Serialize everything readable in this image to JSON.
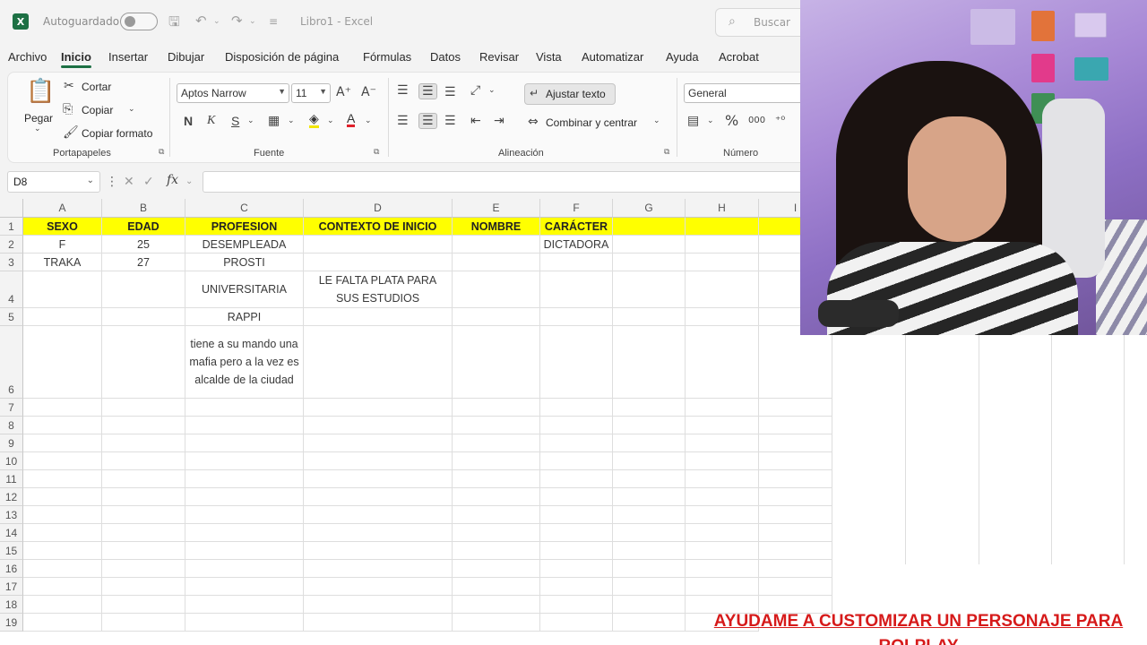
{
  "titlebar": {
    "autosave_label": "Autoguardado",
    "doc_title": "Libro1  -  Excel",
    "search_placeholder": "Buscar"
  },
  "menu": [
    "Archivo",
    "Inicio",
    "Insertar",
    "Dibujar",
    "Disposición de página",
    "Fórmulas",
    "Datos",
    "Revisar",
    "Vista",
    "Automatizar",
    "Ayuda",
    "Acrobat"
  ],
  "active_menu": "Inicio",
  "ribbon": {
    "clipboard": {
      "paste": "Pegar",
      "cut": "Cortar",
      "copy": "Copiar",
      "format_painter": "Copiar formato",
      "label": "Portapapeles"
    },
    "font": {
      "name": "Aptos Narrow",
      "size": "11",
      "bold": "N",
      "italic": "K",
      "underline": "S",
      "label": "Fuente"
    },
    "alignment": {
      "wrap_text": "Ajustar texto",
      "merge_center": "Combinar y centrar",
      "label": "Alineación"
    },
    "number": {
      "format": "General",
      "percent": "%",
      "thousands": "000",
      "label": "Número"
    }
  },
  "formula_bar": {
    "name_box": "D8",
    "fx": "fx",
    "value": ""
  },
  "columns": [
    "A",
    "B",
    "C",
    "D",
    "E",
    "F",
    "G",
    "H",
    "I"
  ],
  "rows": [
    "1",
    "2",
    "3",
    "4",
    "5",
    "6",
    "7",
    "8",
    "9",
    "10",
    "11",
    "12",
    "13",
    "14",
    "15",
    "16",
    "17",
    "18",
    "19"
  ],
  "sheet": {
    "header": [
      "SEXO",
      "EDAD",
      "PROFESION",
      "CONTEXTO DE INICIO",
      "NOMBRE",
      "CARÁCTER",
      "",
      "",
      ""
    ],
    "r2": [
      "F",
      "25",
      "DESEMPLEADA",
      "",
      "",
      "DICTADORA"
    ],
    "r3": [
      "TRAKA",
      "27",
      "PROSTI",
      "",
      "",
      ""
    ],
    "r4": [
      "",
      "",
      "UNIVERSITARIA",
      "LE FALTA PLATA PARA SUS ESTUDIOS",
      "",
      ""
    ],
    "r5": [
      "",
      "",
      "RAPPI",
      "",
      "",
      ""
    ],
    "r6": [
      "",
      "",
      "tiene a su mando una mafia pero a la vez es alcalde de la ciudad",
      "",
      "",
      ""
    ]
  },
  "caption": {
    "line1": "AYUDAME A CUSTOMIZAR UN PERSONAJE PARA",
    "line2": "ROLPLAY"
  },
  "colors": {
    "excel_green": "#1d7044",
    "header_yellow": "#ffff00",
    "caption_red": "#d61a1a"
  }
}
